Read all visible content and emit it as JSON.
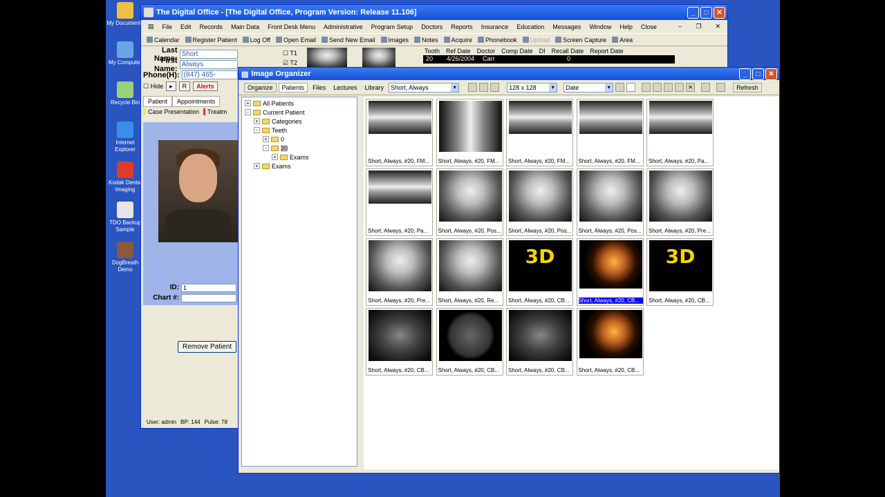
{
  "desktop": {
    "icons": [
      {
        "label": "My Documents"
      },
      {
        "label": "My Computer"
      },
      {
        "label": "Recycle Bin"
      },
      {
        "label": "Internet Explorer"
      },
      {
        "label": "Kodak Dental Imaging"
      },
      {
        "label": "TDO Backup Sample"
      },
      {
        "label": "DogBreath Demo"
      }
    ]
  },
  "main_window": {
    "title": "The Digital Office - [The Digital Office, Program Version: Release 11.106]",
    "menu": [
      "File",
      "Edit",
      "Records",
      "Main Data",
      "Front Desk Menu",
      "Administrative",
      "Program Setup",
      "Doctors",
      "Reports",
      "Insurance",
      "Education",
      "Messages",
      "Window",
      "Help",
      "Close"
    ],
    "toolbar": [
      "Calendar",
      "Register Patient",
      "Log Off",
      "Open Email",
      "Send New Email",
      "Images",
      "Notes",
      "Acquire",
      "Phonebook",
      "Upload",
      "Screen Capture",
      "Area"
    ],
    "patient": {
      "last_name_label": "Last Name:",
      "last_name": "Short",
      "first_name_label": "First Name:",
      "first_name": "Always",
      "phone_label": "Phone(H):",
      "phone": "(847) 465-",
      "t1": "T1",
      "t2": "T2",
      "hide": "Hide",
      "r": "R",
      "alerts": "Alerts"
    },
    "tooth_table": {
      "headers": [
        "Tooth",
        "Ref Date",
        "Doctor",
        "Comp Date",
        "DI",
        "Recall Date",
        "Report Date"
      ],
      "row": [
        "20",
        "4/26/2004",
        "Carr",
        "",
        "0",
        "",
        ""
      ]
    },
    "tabs": [
      "Patient",
      "Appointments"
    ],
    "case_tabs": [
      "Case Presentation",
      "Treatm"
    ],
    "id_label": "ID:",
    "id_value": "1",
    "chart_label": "Chart #:",
    "chart_value": "",
    "remove_patient": "Remove Patient",
    "status": {
      "user": "User: admin",
      "bp": "BP: 144",
      "pulse": "Pulse: 78"
    }
  },
  "organizer": {
    "title": "Image Organizer",
    "tabs": [
      "Organize",
      "Patients",
      "Files",
      "Lectures",
      "Library"
    ],
    "patient_combo": "Short, Always",
    "size_combo": "128 x 128",
    "sort_combo": "Date",
    "refresh": "Refresh",
    "tree": [
      {
        "label": "All Patients",
        "depth": 0,
        "exp": "+"
      },
      {
        "label": "Current Patient",
        "depth": 0,
        "exp": "-"
      },
      {
        "label": "Categories",
        "depth": 1,
        "exp": "+"
      },
      {
        "label": "Teeth",
        "depth": 1,
        "exp": "-"
      },
      {
        "label": "0",
        "depth": 2,
        "exp": "+"
      },
      {
        "label": "20",
        "depth": 2,
        "exp": "-"
      },
      {
        "label": "Exams",
        "depth": 3,
        "exp": "+"
      },
      {
        "label": "Exams",
        "depth": 1,
        "exp": "+"
      }
    ],
    "thumbnails": [
      {
        "caption": "Short, Always, #20, FM...",
        "kind": "pano"
      },
      {
        "caption": "Short, Always, #20, FM...",
        "kind": "xray-tall"
      },
      {
        "caption": "Short, Always, #20, FM...",
        "kind": "pano"
      },
      {
        "caption": "Short, Always, #20, FM...",
        "kind": "pano"
      },
      {
        "caption": "Short, Always, #20, Pa...",
        "kind": "pano"
      },
      {
        "caption": "Short, Always, #20, Pa...",
        "kind": "pano"
      },
      {
        "caption": "Short, Always, #20, Pos...",
        "kind": "xray"
      },
      {
        "caption": "Short, Always, #20, Pos...",
        "kind": "xray"
      },
      {
        "caption": "Short, Always, #20, Pos...",
        "kind": "xray"
      },
      {
        "caption": "Short, Always, #20, Pre...",
        "kind": "xray"
      },
      {
        "caption": "Short, Always, #20, Pre...",
        "kind": "xray"
      },
      {
        "caption": "Short, Always, #20, Re...",
        "kind": "xray"
      },
      {
        "caption": "Short, Always, #20, CB...",
        "kind": "threed"
      },
      {
        "caption": "Short, Always, #20, CB...",
        "kind": "model",
        "selected": true
      },
      {
        "caption": "Short, Always, #20, CB...",
        "kind": "threed"
      },
      {
        "caption": "Short, Always, #20, CB...",
        "kind": "ct"
      },
      {
        "caption": "Short, Always, #20, CB...",
        "kind": "ct-round"
      },
      {
        "caption": "Short, Always, #20, CB...",
        "kind": "ct"
      },
      {
        "caption": "Short, Always, #20, CB...",
        "kind": "model"
      }
    ]
  }
}
